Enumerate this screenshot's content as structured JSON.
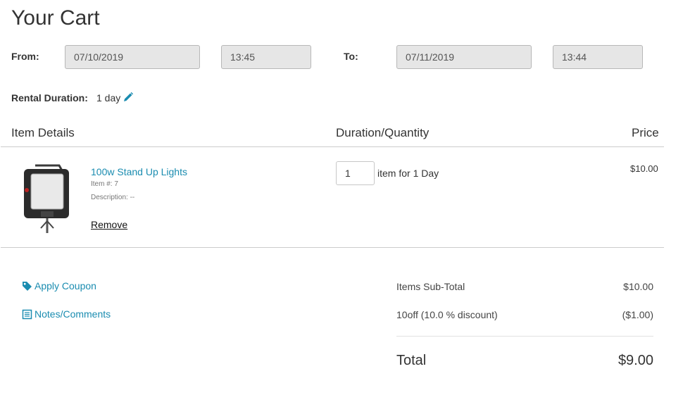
{
  "page": {
    "title": "Your Cart"
  },
  "dates": {
    "from_label": "From:",
    "from_date": "07/10/2019",
    "from_time": "13:45",
    "to_label": "To:",
    "to_date": "07/11/2019",
    "to_time": "13:44"
  },
  "rental": {
    "label": "Rental Duration:",
    "value": "1 day",
    "edit_icon": "pencil-icon"
  },
  "table": {
    "headers": [
      "Item Details",
      "Duration/Quantity",
      "Price"
    ]
  },
  "item": {
    "name": "100w Stand Up Lights",
    "number_line": "Item #: 7",
    "description_line": "Description: --",
    "remove_label": "Remove",
    "quantity": "1",
    "quantity_suffix": "item for 1 Day",
    "price": "$10.00",
    "image_icon": "stand-light-image"
  },
  "actions": {
    "coupon_label": "Apply Coupon",
    "coupon_icon": "tag-icon",
    "notes_label": "Notes/Comments",
    "notes_icon": "notes-icon"
  },
  "summary": {
    "subtotal_label": "Items Sub-Total",
    "subtotal_value": "$10.00",
    "discount_label": "10off (10.0 % discount)",
    "discount_value": "($1.00)",
    "total_label": "Total",
    "total_value": "$9.00"
  },
  "colors": {
    "link": "#1a8cb0",
    "field_bg": "#e6e6e6",
    "rule": "#cccccc"
  }
}
